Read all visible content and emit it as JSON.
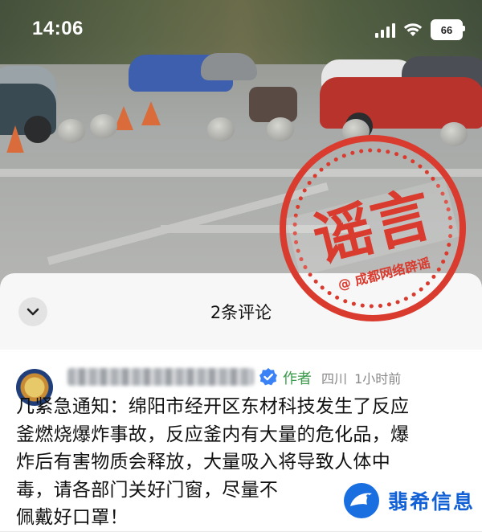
{
  "status_bar": {
    "time": "14:06",
    "battery_level": "66"
  },
  "stamp": {
    "title": "谣言",
    "caption": "@ 成都网络辟谣",
    "color": "#d93b2f"
  },
  "comments_sheet": {
    "title": "2条评论",
    "comment": {
      "author_badge": "作者",
      "location": "四川",
      "time_ago": "1小时前",
      "lines": [
        "几紧急通知：绵阳市经开区东材科技发生了反应",
        "釜燃烧爆炸事故，反应釜内有大量的危化品，爆",
        "炸后有害物质会释放，大量吸入将导致人体中",
        "毒，请各部门关好门窗，尽量不",
        "佩戴好口罩！"
      ]
    }
  },
  "watermark": {
    "text": "翡希信息",
    "color": "#1160d6"
  }
}
